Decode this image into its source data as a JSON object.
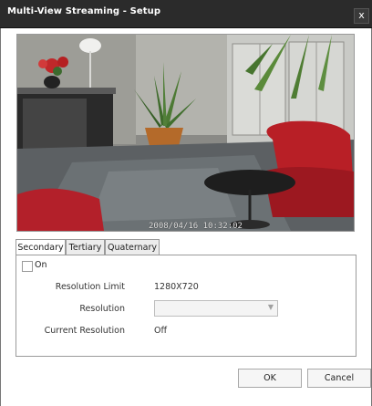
{
  "window": {
    "title": "Multi-View Streaming - Setup",
    "close_glyph": "x"
  },
  "preview": {
    "timestamp": "2008/04/16 10:32:02"
  },
  "tabs": [
    {
      "label": "Secondary",
      "active": true
    },
    {
      "label": "Tertiary",
      "active": false
    },
    {
      "label": "Quaternary",
      "active": false
    }
  ],
  "settings": {
    "on_label": "On",
    "on_checked": false,
    "resolution_limit_label": "Resolution Limit",
    "resolution_limit_value": "1280X720",
    "resolution_label": "Resolution",
    "resolution_value": "",
    "current_resolution_label": "Current Resolution",
    "current_resolution_value": "Off"
  },
  "buttons": {
    "ok": "OK",
    "cancel": "Cancel"
  }
}
